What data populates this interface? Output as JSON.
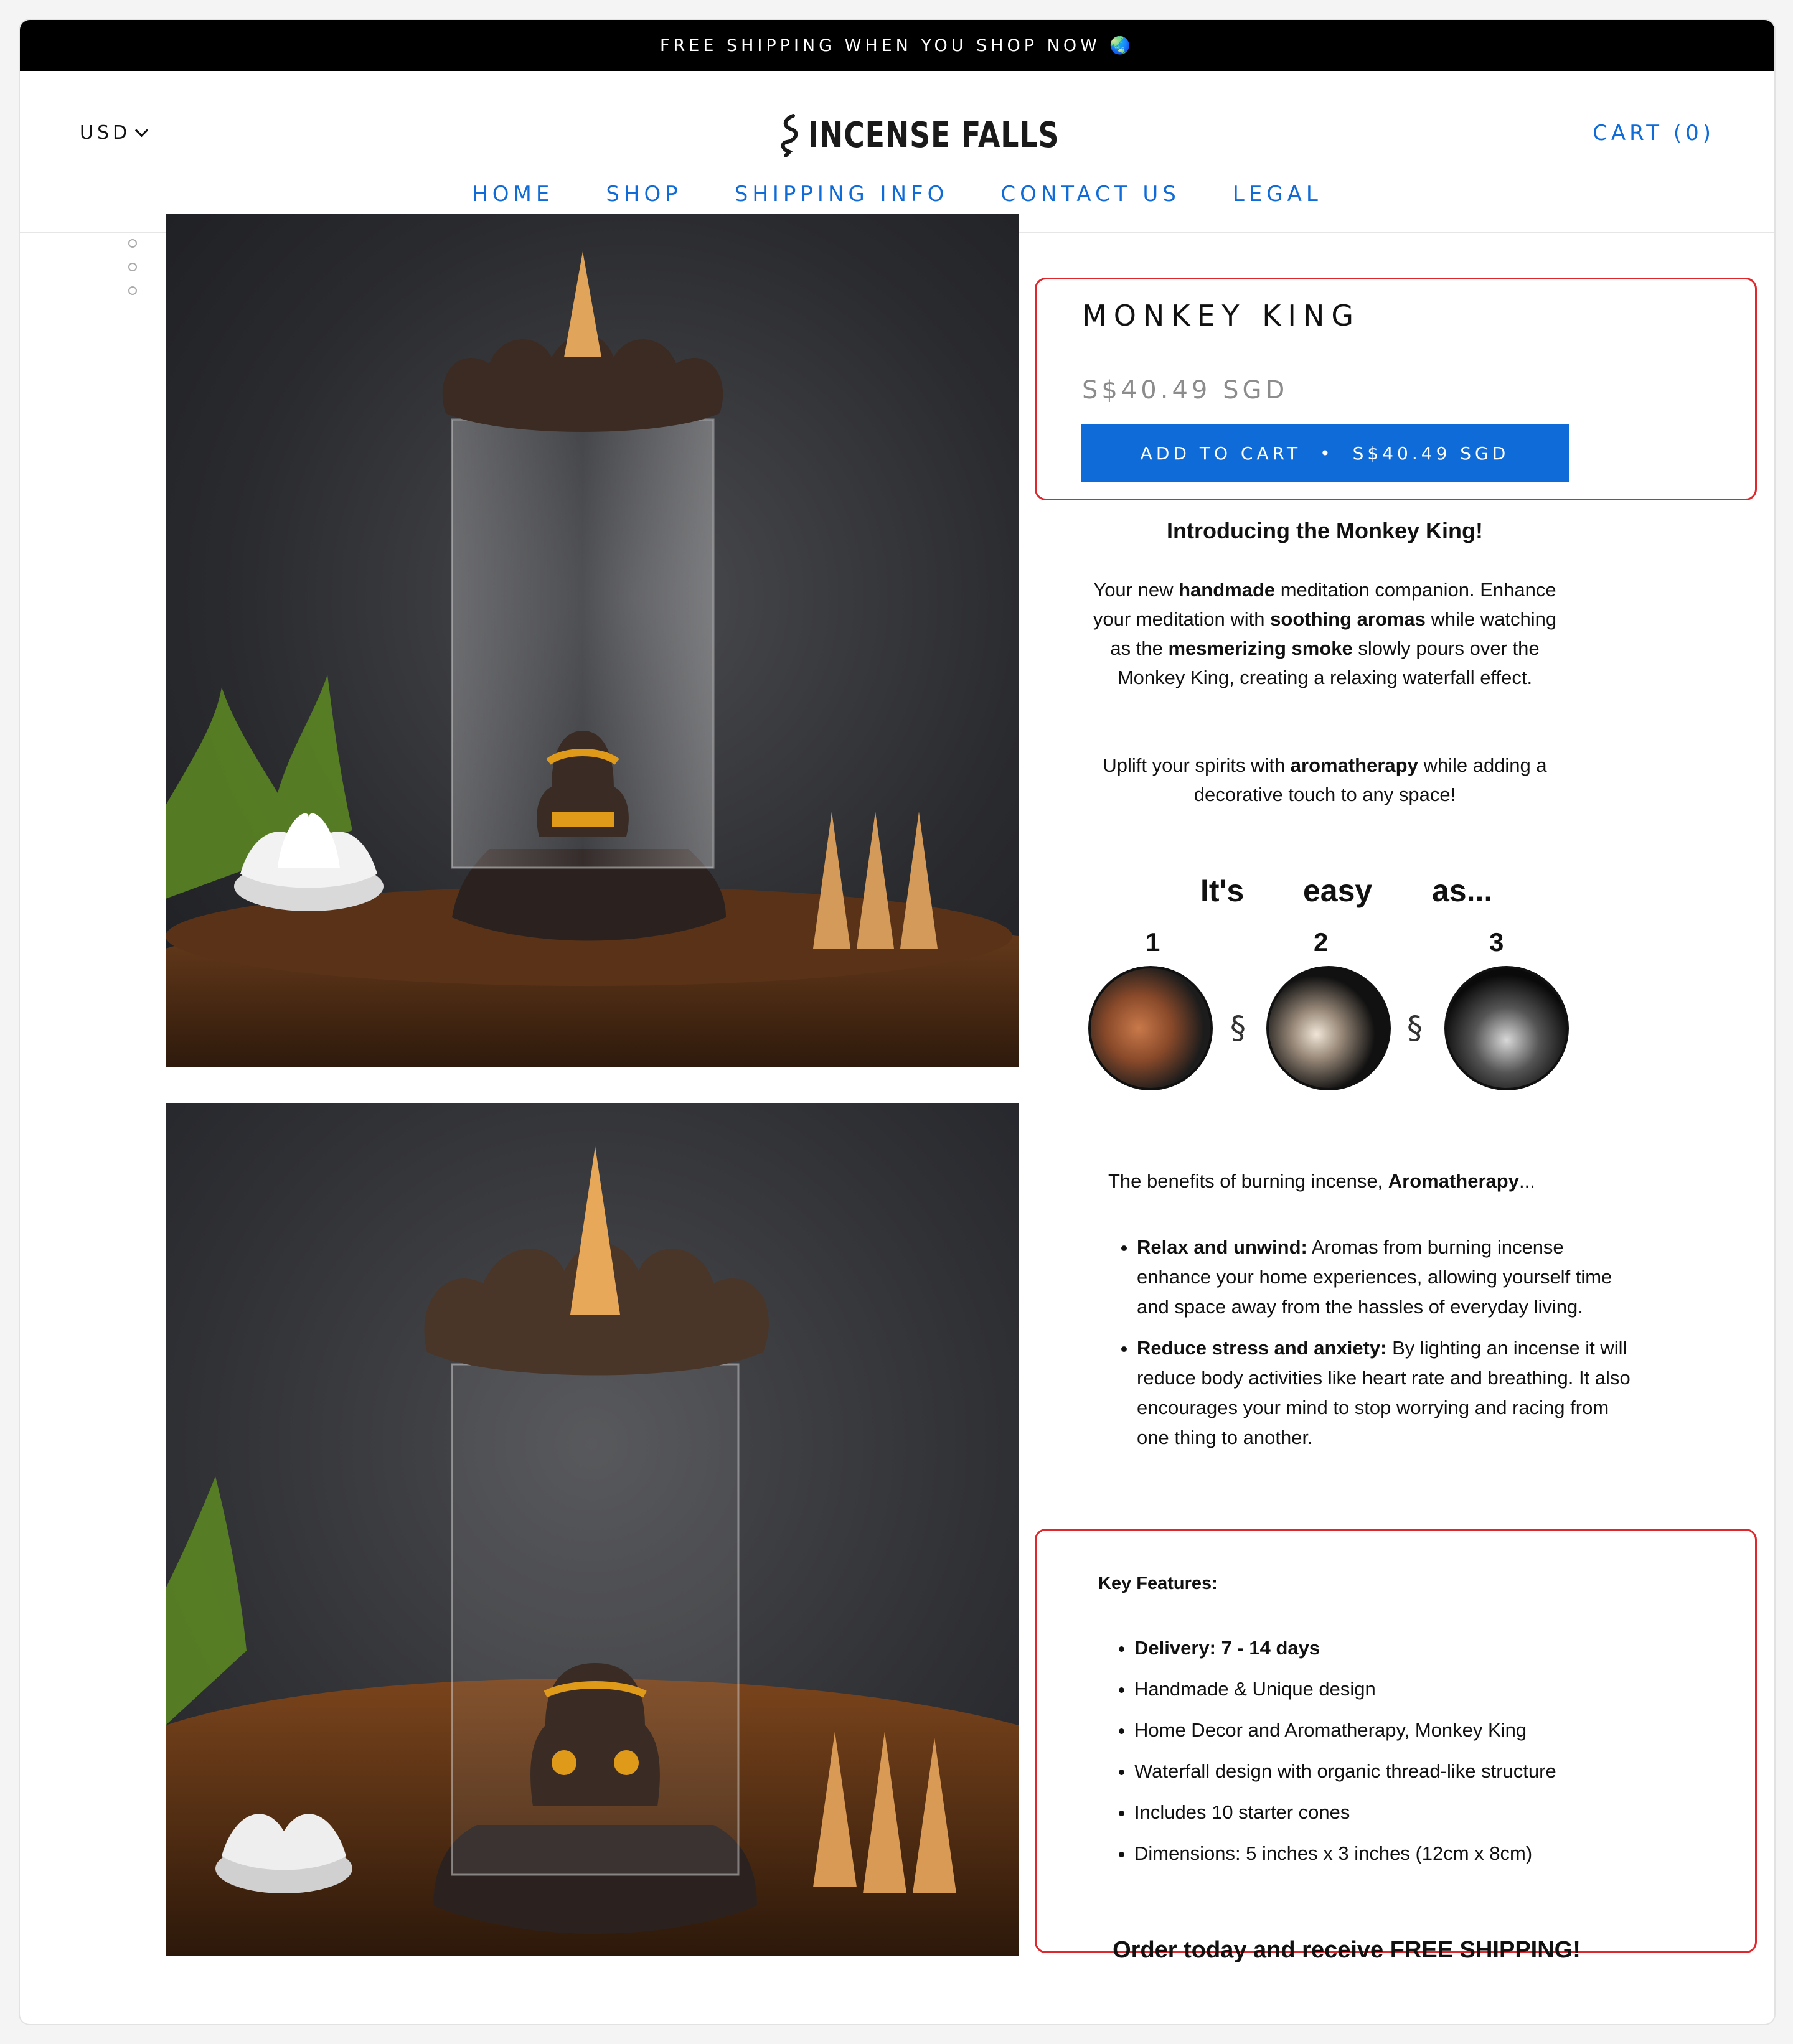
{
  "announcement": "FREE SHIPPING WHEN YOU SHOP NOW 🌏",
  "header": {
    "currency": "USD",
    "logo_text": "INCENSE FALLS",
    "cart_label": "CART (0)"
  },
  "nav": {
    "items": [
      {
        "label": "HOME"
      },
      {
        "label": "SHOP"
      },
      {
        "label": "SHIPPING INFO"
      },
      {
        "label": "CONTACT US"
      },
      {
        "label": "LEGAL"
      }
    ]
  },
  "product": {
    "title": "MONKEY KING",
    "price": "S$40.49 SGD",
    "add_to_cart_label": "ADD TO CART",
    "add_to_cart_separator": "•",
    "add_to_cart_price": "S$40.49 SGD"
  },
  "description": {
    "intro_heading": "Introducing the Monkey King!",
    "para1": [
      {
        "t": "Your new "
      },
      {
        "t": "handmade",
        "b": true
      },
      {
        "t": " meditation companion. Enhance your meditation with "
      },
      {
        "t": "soothing aromas",
        "b": true
      },
      {
        "t": " while watching as the "
      },
      {
        "t": "mesmerizing smoke",
        "b": true
      },
      {
        "t": " slowly pours over the Monkey King, creating a relaxing waterfall effect."
      }
    ],
    "para2": [
      {
        "t": "Uplift your spirits with "
      },
      {
        "t": "aromatherapy",
        "b": true
      },
      {
        "t": " while adding a decorative touch to any space!"
      }
    ]
  },
  "easy": {
    "words": [
      "It's",
      "easy",
      "as..."
    ],
    "steps": [
      "1",
      "2",
      "3"
    ]
  },
  "benefits": {
    "heading_prefix": "The benefits of burning incense, ",
    "heading_bold": "Aromatherapy",
    "heading_suffix": "...",
    "items": [
      {
        "bold": "Relax and unwind:",
        "text": " Aromas from burning incense enhance your home experiences, allowing yourself time and space away from the hassles of everyday living."
      },
      {
        "bold": "Reduce stress and anxiety:",
        "text": " By lighting an incense it will reduce body activities like heart rate and breathing. It also encourages your mind to stop worrying and racing from one thing to another."
      }
    ]
  },
  "key_features": {
    "heading": "Key Features:",
    "items": [
      {
        "text": "Delivery: 7 - 14 days",
        "bold": true
      },
      {
        "text": "Handmade & Unique design"
      },
      {
        "text": "Home Decor and Aromatherapy, Monkey King"
      },
      {
        "text": "Waterfall design with organic thread-like structure"
      },
      {
        "text": "Includes 10 starter cones"
      },
      {
        "text": "Dimensions: 5 inches x 3 inches (12cm x 8cm)"
      }
    ],
    "closing": "Order today and receive FREE SHIPPING!"
  },
  "colors": {
    "accent": "#0e6bd8",
    "highlight_box": "#e0272b",
    "announcement_bg": "#000000"
  }
}
